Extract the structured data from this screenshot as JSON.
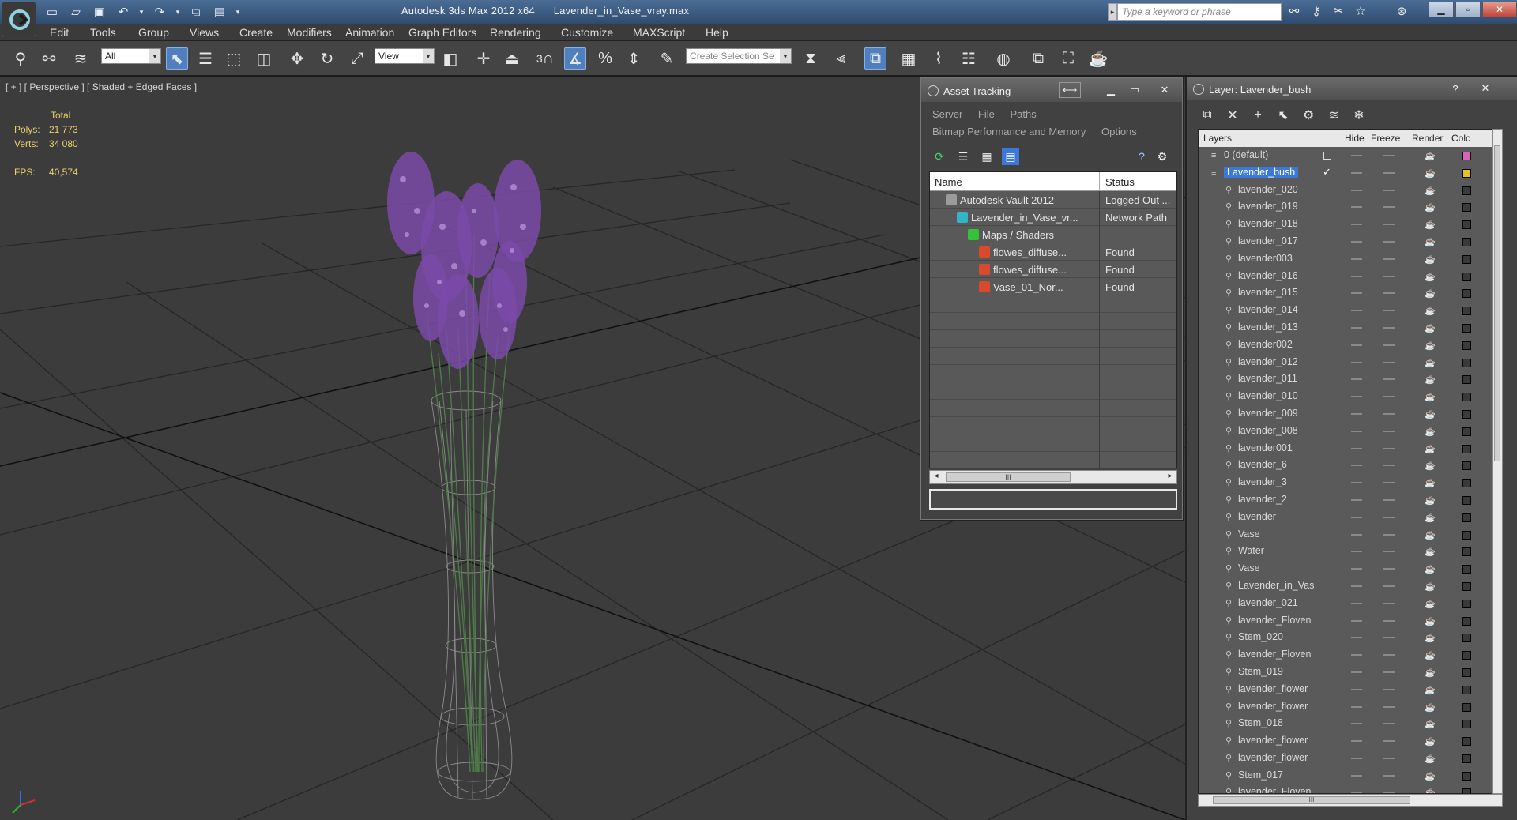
{
  "window": {
    "app_title": "Autodesk 3ds Max  2012 x64",
    "file_name": "Lavender_in_Vase_vray.max",
    "search_placeholder": "Type a keyword or phrase"
  },
  "menu": [
    "Edit",
    "Tools",
    "Group",
    "Views",
    "Create",
    "Modifiers",
    "Animation",
    "Graph Editors",
    "Rendering",
    "Customize",
    "MAXScript",
    "Help"
  ],
  "toolbar": {
    "selection_filter": "All",
    "reference_coord": "View",
    "snap_label": "3",
    "named_selection_placeholder": "Create Selection Se"
  },
  "viewport": {
    "label": "[ + ] [ Perspective ] [ Shaded + Edged Faces ]",
    "stats_header": "Total",
    "polys_label": "Polys:",
    "polys_value": "21 773",
    "verts_label": "Verts:",
    "verts_value": "34 080",
    "fps_label": "FPS:",
    "fps_value": "40,574"
  },
  "asset_tracking": {
    "title": "Asset Tracking",
    "menu_row1": [
      "Server",
      "File",
      "Paths"
    ],
    "menu_row2": [
      "Bitmap Performance and Memory",
      "Options"
    ],
    "col_name": "Name",
    "col_status": "Status",
    "rows": [
      {
        "name": "Autodesk Vault 2012",
        "status": "Logged Out ...",
        "indent": 1,
        "icon": "vault-icon",
        "color": "#9a9a9a"
      },
      {
        "name": "Lavender_in_Vase_vr...",
        "status": "Network Path",
        "indent": 2,
        "icon": "max-file-icon",
        "color": "#33b4c8"
      },
      {
        "name": "Maps / Shaders",
        "status": "",
        "indent": 3,
        "icon": "maps-folder-icon",
        "color": "#35c13a"
      },
      {
        "name": "flowes_diffuse...",
        "status": "Found",
        "indent": 4,
        "icon": "bitmap-file-icon",
        "color": "#d84a2a"
      },
      {
        "name": "flowes_diffuse...",
        "status": "Found",
        "indent": 4,
        "icon": "bitmap-file-icon",
        "color": "#d84a2a"
      },
      {
        "name": "Vase_01_Nor...",
        "status": "Found",
        "indent": 4,
        "icon": "bitmap-file-icon",
        "color": "#d84a2a"
      }
    ],
    "scroll_grip": "III"
  },
  "layer_manager": {
    "title": "Layer: Lavender_bush",
    "help": "?",
    "col_layers": "Layers",
    "col_hide": "Hide",
    "col_freeze": "Freeze",
    "col_render": "Render",
    "col_color": "Colc",
    "scroll_grip": "III",
    "layers": [
      {
        "name": "0 (default)",
        "level": 0,
        "color": "#e060c0"
      },
      {
        "name": "Lavender_bush",
        "level": 0,
        "color": "#e8c020",
        "selected": true,
        "current": true
      },
      {
        "name": "lavender_020",
        "level": 1
      },
      {
        "name": "lavender_019",
        "level": 1
      },
      {
        "name": "lavender_018",
        "level": 1
      },
      {
        "name": "lavender_017",
        "level": 1
      },
      {
        "name": "lavender003",
        "level": 1
      },
      {
        "name": "lavender_016",
        "level": 1
      },
      {
        "name": "lavender_015",
        "level": 1
      },
      {
        "name": "lavender_014",
        "level": 1
      },
      {
        "name": "lavender_013",
        "level": 1
      },
      {
        "name": "lavender002",
        "level": 1
      },
      {
        "name": "lavender_012",
        "level": 1
      },
      {
        "name": "lavender_011",
        "level": 1
      },
      {
        "name": "lavender_010",
        "level": 1
      },
      {
        "name": "lavender_009",
        "level": 1
      },
      {
        "name": "lavender_008",
        "level": 1
      },
      {
        "name": "lavender001",
        "level": 1
      },
      {
        "name": "lavender_6",
        "level": 1
      },
      {
        "name": "lavender_3",
        "level": 1
      },
      {
        "name": "lavender_2",
        "level": 1
      },
      {
        "name": "lavender",
        "level": 1
      },
      {
        "name": "Vase",
        "level": 1
      },
      {
        "name": "Water",
        "level": 1
      },
      {
        "name": "Vase",
        "level": 1
      },
      {
        "name": "Lavender_in_Vas",
        "level": 1
      },
      {
        "name": "lavender_021",
        "level": 1
      },
      {
        "name": "lavender_Floven",
        "level": 1
      },
      {
        "name": "Stem_020",
        "level": 1
      },
      {
        "name": "lavender_Floven",
        "level": 1
      },
      {
        "name": "Stem_019",
        "level": 1
      },
      {
        "name": "lavender_flower",
        "level": 1
      },
      {
        "name": "lavender_flower",
        "level": 1
      },
      {
        "name": "Stem_018",
        "level": 1
      },
      {
        "name": "lavender_flower",
        "level": 1
      },
      {
        "name": "lavender_flower",
        "level": 1
      },
      {
        "name": "Stem_017",
        "level": 1
      },
      {
        "name": "lavender_Floven",
        "level": 1
      }
    ]
  },
  "colors": {
    "title_bar": "#3a5a82",
    "selection_blue": "#3c78d8",
    "stats_text": "#e8d26a",
    "viewport_bg": "#3c3c3c",
    "lavender": "#8a4fb5"
  }
}
